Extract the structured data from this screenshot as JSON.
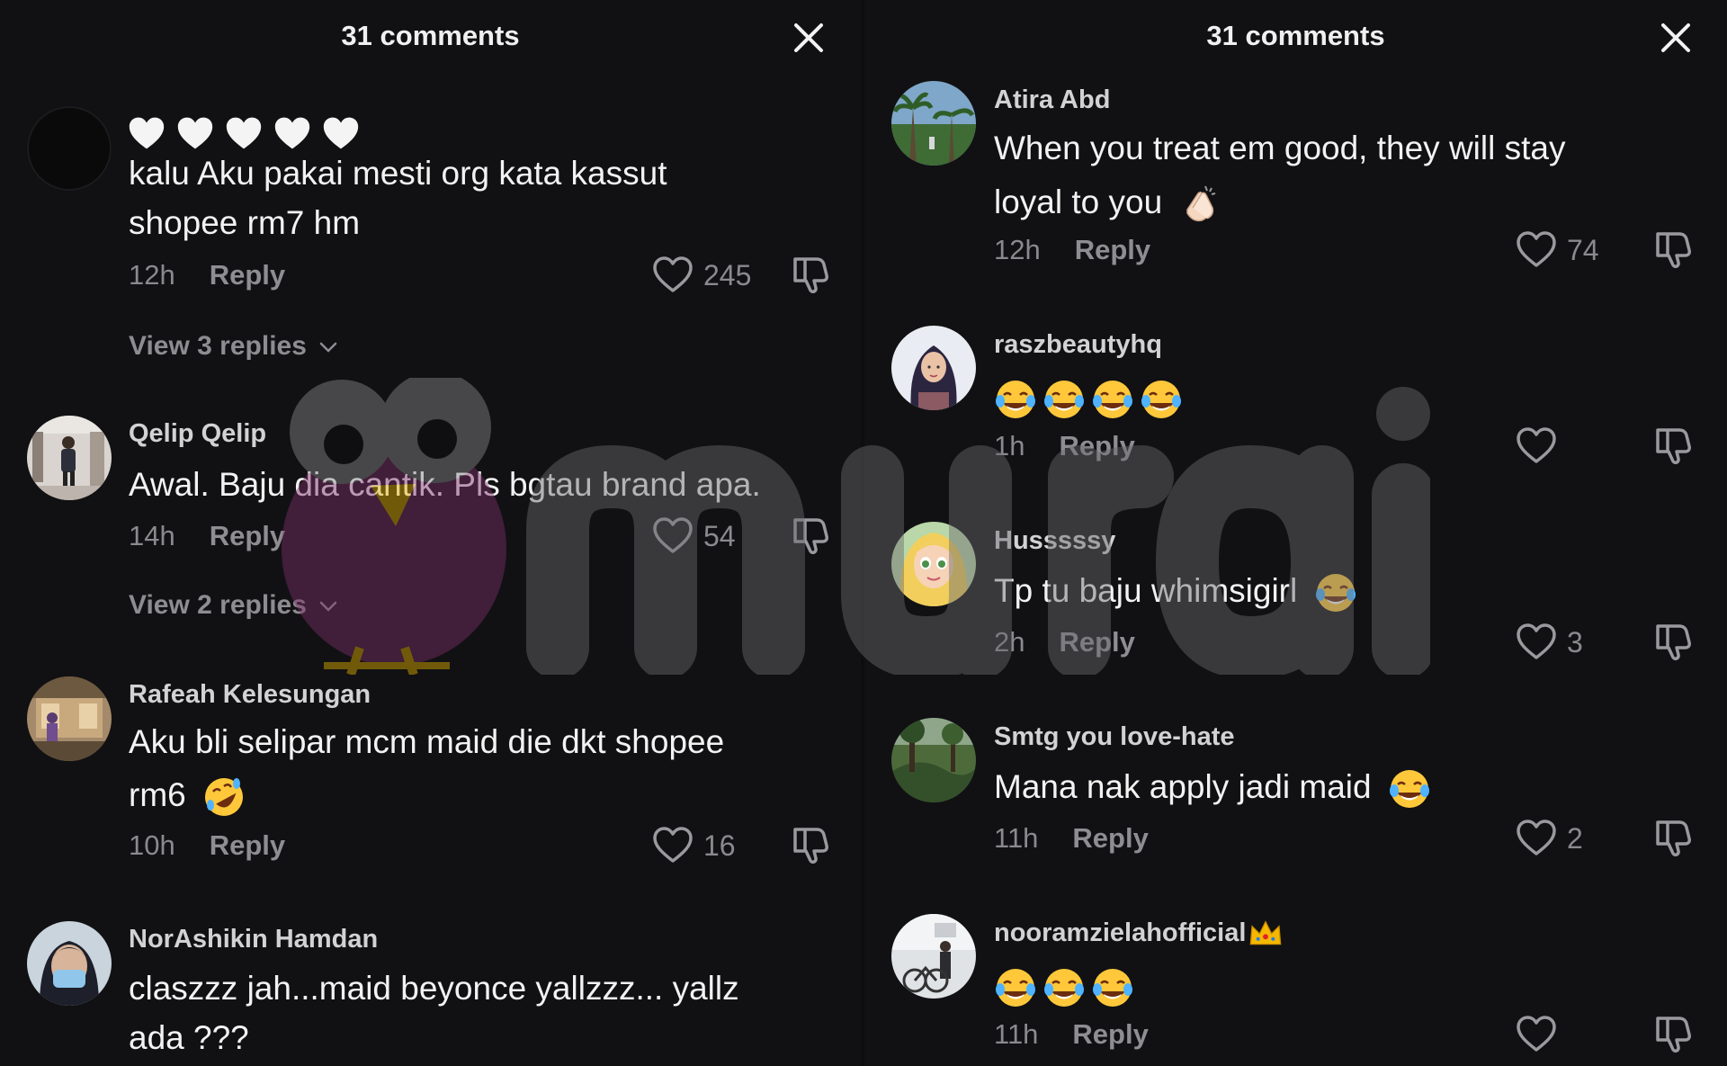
{
  "left_panel": {
    "title": "31 comments",
    "comments": [
      {
        "username": "",
        "emoji_prefix": [
          "white-heart",
          "white-heart",
          "white-heart",
          "white-heart",
          "white-heart"
        ],
        "lines": [
          "kalu Aku pakai mesti org kata kassut",
          "shopee rm7 hm"
        ],
        "time": "12h",
        "reply": "Reply",
        "likes": "245",
        "view_replies": "View 3 replies"
      },
      {
        "username": "Qelip Qelip",
        "lines": [
          "Awal. Baju dia cantik. Pls bgtau brand apa."
        ],
        "time": "14h",
        "reply": "Reply",
        "likes": "54",
        "view_replies": "View 2 replies"
      },
      {
        "username": "Rafeah Kelesungan",
        "lines": [
          "Aku bli selipar mcm maid die dkt shopee",
          "rm6"
        ],
        "line2_emoji": "rolling-laughing",
        "time": "10h",
        "reply": "Reply",
        "likes": "16"
      },
      {
        "username": "NorAshikin Hamdan",
        "lines": [
          "claszzz jah...maid beyonce yallzzz... yallz",
          "ada ???"
        ]
      }
    ]
  },
  "right_panel": {
    "title": "31 comments",
    "comments": [
      {
        "username": "Atira Abd",
        "lines": [
          "When you treat em good, they will stay",
          "loyal to you"
        ],
        "line2_emoji": "clapping-hands",
        "time": "12h",
        "reply": "Reply",
        "likes": "74"
      },
      {
        "username": "raszbeautyhq",
        "emoji_only": [
          "tears-of-joy",
          "tears-of-joy",
          "tears-of-joy",
          "tears-of-joy"
        ],
        "time": "1h",
        "reply": "Reply",
        "likes": ""
      },
      {
        "username": "Husssssy",
        "lines": [
          "Tp tu baju whimsigirl"
        ],
        "line1_emoji": "tears-of-joy",
        "time": "2h",
        "reply": "Reply",
        "likes": "3"
      },
      {
        "username": "Smtg you love-hate",
        "lines": [
          "Mana nak apply jadi maid"
        ],
        "line1_emoji": "tears-of-joy",
        "time": "11h",
        "reply": "Reply",
        "likes": "2"
      },
      {
        "username": "nooramzielahofficial",
        "username_emoji": "crown",
        "emoji_only": [
          "tears-of-joy",
          "tears-of-joy",
          "tears-of-joy"
        ],
        "time": "11h",
        "reply": "Reply",
        "likes": ""
      }
    ]
  },
  "watermark": {
    "text": "murai",
    "mascot": "owl-mascot"
  },
  "colors": {
    "background": "#111113",
    "text_primary": "#f2f2f2",
    "text_secondary": "#8a8a8e",
    "watermark_purple": "#7d2e6b",
    "watermark_gray": "#6a6a6e",
    "beak_yellow": "#e3b400"
  }
}
